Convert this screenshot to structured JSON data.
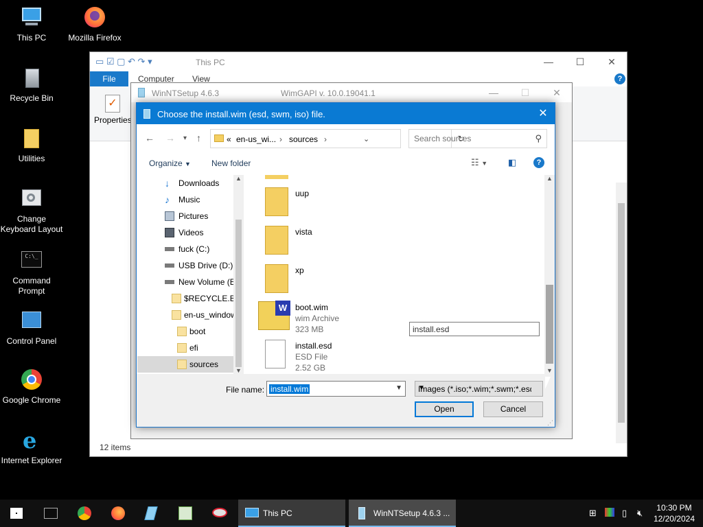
{
  "desktop": {
    "icons": [
      {
        "label": "This PC"
      },
      {
        "label": "Mozilla Firefox"
      },
      {
        "label": "Recycle Bin"
      },
      {
        "label": "Utilities"
      },
      {
        "label": "Change Keyboard Layout"
      },
      {
        "label": "Command Prompt"
      },
      {
        "label": "Control Panel"
      },
      {
        "label": "Google Chrome"
      },
      {
        "label": "Internet Explorer"
      }
    ]
  },
  "explorer": {
    "title": "This PC",
    "tabs": {
      "file": "File",
      "computer": "Computer",
      "view": "View"
    },
    "ribbon_properties": "Properties",
    "status": "12 items"
  },
  "winntsetup": {
    "title": "WinNTSetup 4.6.3",
    "subtitle": "WimGAPI v. 10.0.19041.1"
  },
  "dialog": {
    "title": "Choose the install.wim (esd, swm, iso) file.",
    "address": {
      "prefix": "«",
      "seg1": "en-us_wi...",
      "seg2": "sources"
    },
    "search_placeholder": "Search sources",
    "toolbar": {
      "organize": "Organize",
      "new_folder": "New folder"
    },
    "tree": [
      {
        "label": "Downloads"
      },
      {
        "label": "Music"
      },
      {
        "label": "Pictures"
      },
      {
        "label": "Videos"
      },
      {
        "label": "fuck (C:)"
      },
      {
        "label": "USB Drive (D:)"
      },
      {
        "label": "New Volume (E"
      },
      {
        "label": "$RECYCLE.BIN"
      },
      {
        "label": "en-us_window"
      },
      {
        "label": "boot"
      },
      {
        "label": "efi"
      },
      {
        "label": "sources"
      }
    ],
    "files": [
      {
        "name": "uup"
      },
      {
        "name": "vista"
      },
      {
        "name": "xp"
      },
      {
        "name": "boot.wim",
        "type": "wim Archive",
        "size": "323 MB"
      },
      {
        "name": "install.esd",
        "type": "ESD File",
        "size": "2.52 GB"
      }
    ],
    "rename_value": "install.esd",
    "file_name_label": "File name:",
    "file_name_value": "install.wim",
    "file_type": "Images (*.iso;*.wim;*.swm;*.esd)",
    "open_label": "Open",
    "cancel_label": "Cancel"
  },
  "taskbar": {
    "apps": [
      {
        "label": "This PC"
      },
      {
        "label": "WinNTSetup 4.6.3 ..."
      }
    ],
    "time": "10:30 PM",
    "date": "12/20/2024"
  }
}
